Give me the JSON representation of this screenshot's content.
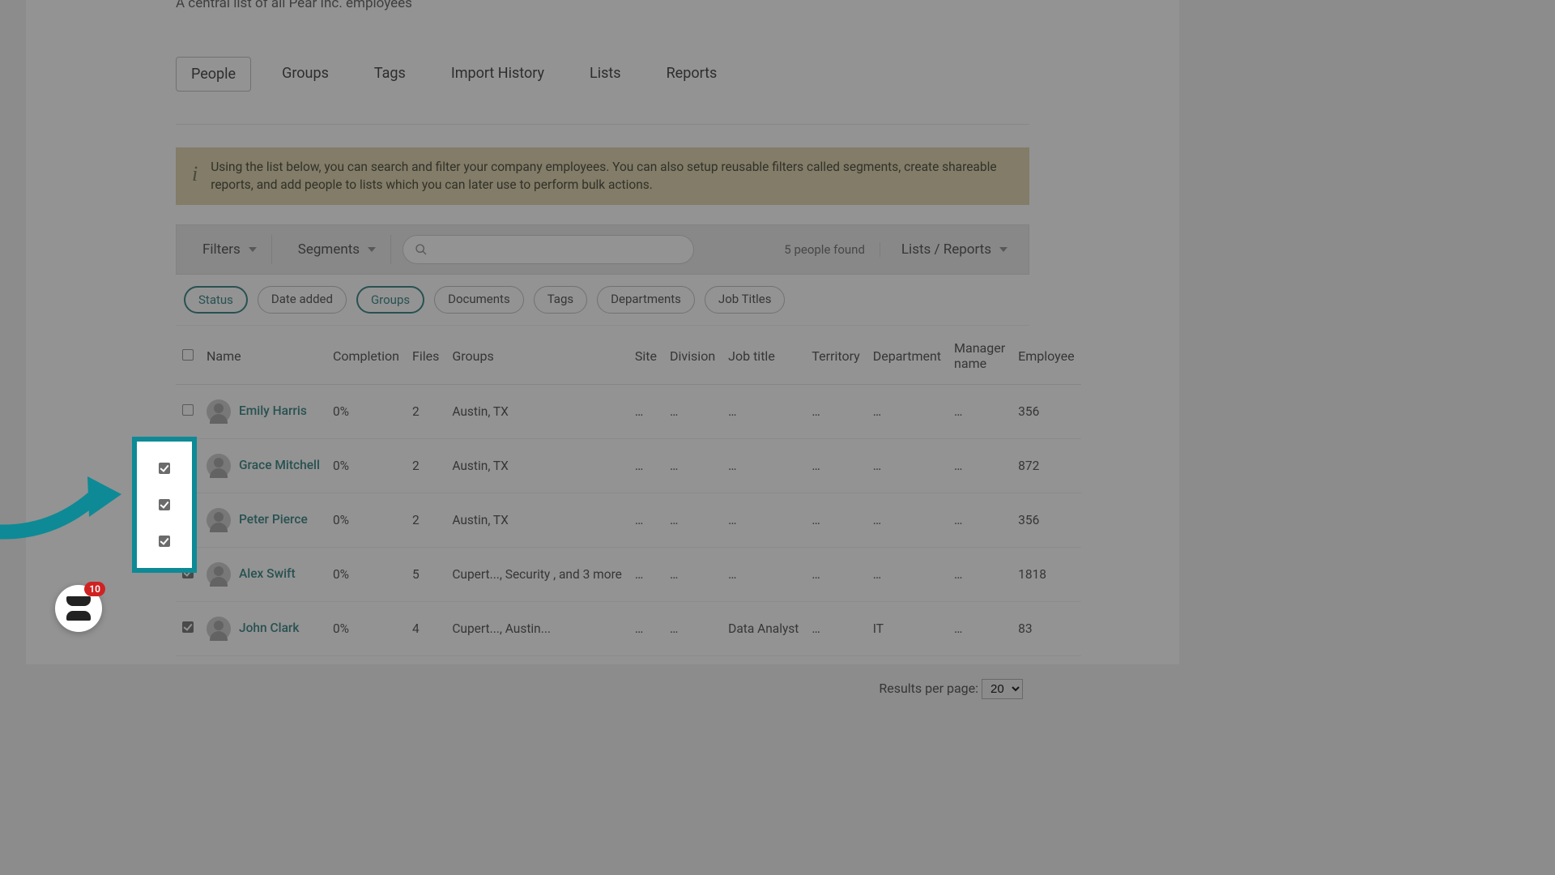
{
  "subtitle": "A central list of all Pear Inc. employees",
  "tabs": [
    "People",
    "Groups",
    "Tags",
    "Import History",
    "Lists",
    "Reports"
  ],
  "active_tab": 0,
  "banner": "Using the list below, you can search and filter your company employees. You can also setup reusable filters called segments, create shareable reports, and add people to lists which you can later use to perform bulk actions.",
  "toolbar": {
    "filters": "Filters",
    "segments": "Segments",
    "count": "5 people found",
    "lists_reports": "Lists / Reports",
    "search_placeholder": ""
  },
  "chips": [
    "Status",
    "Date added",
    "Groups",
    "Documents",
    "Tags",
    "Departments",
    "Job Titles"
  ],
  "chip_active": [
    0,
    2
  ],
  "columns": [
    "",
    "Name",
    "Completion",
    "Files",
    "Groups",
    "Site",
    "Division",
    "Job title",
    "Territory",
    "Department",
    "Manager name",
    "Employee"
  ],
  "rows": [
    {
      "checked": false,
      "name": "Emily Harris",
      "completion": "0%",
      "files": "2",
      "groups": "Austin, TX",
      "site": "…",
      "division": "…",
      "job": "…",
      "territory": "…",
      "dept": "…",
      "manager": "…",
      "emp": "356"
    },
    {
      "checked": false,
      "name": "Grace Mitchell",
      "completion": "0%",
      "files": "2",
      "groups": "Austin, TX",
      "site": "…",
      "division": "…",
      "job": "…",
      "territory": "…",
      "dept": "…",
      "manager": "…",
      "emp": "872"
    },
    {
      "checked": true,
      "name": "Peter Pierce",
      "completion": "0%",
      "files": "2",
      "groups": "Austin, TX",
      "site": "…",
      "division": "…",
      "job": "…",
      "territory": "…",
      "dept": "…",
      "manager": "…",
      "emp": "356"
    },
    {
      "checked": true,
      "name": "Alex Swift",
      "completion": "0%",
      "files": "5",
      "groups": "Cupert..., Security , and 3 more",
      "site": "…",
      "division": "…",
      "job": "…",
      "territory": "…",
      "dept": "…",
      "manager": "…",
      "emp": "1818"
    },
    {
      "checked": true,
      "name": "John Clark",
      "completion": "0%",
      "files": "4",
      "groups": "Cupert..., Austin...",
      "site": "…",
      "division": "…",
      "job": "Data Analyst",
      "territory": "…",
      "dept": "IT",
      "manager": "…",
      "emp": "83"
    }
  ],
  "pager": {
    "label": "Results per page:",
    "value": "20"
  },
  "help_count": "10"
}
